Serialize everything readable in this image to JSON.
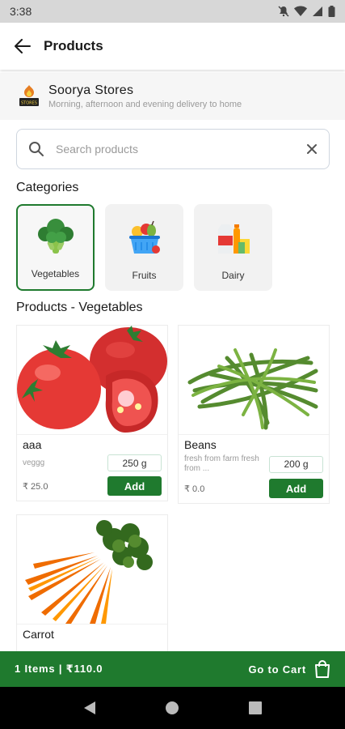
{
  "status_bar": {
    "time": "3:38"
  },
  "app_bar": {
    "title": "Products"
  },
  "store": {
    "name": "Soorya Stores",
    "description": "Morning, afternoon and evening delivery to home"
  },
  "search": {
    "placeholder": "Search products",
    "value": ""
  },
  "categories_title": "Categories",
  "categories": [
    {
      "label": "Vegetables",
      "selected": true
    },
    {
      "label": "Fruits",
      "selected": false
    },
    {
      "label": "Dairy",
      "selected": false
    }
  ],
  "products_title": "Products - Vegetables",
  "products": [
    {
      "name": "aaa",
      "description": "veggg",
      "quantity": "250 g",
      "price": "₹ 25.0",
      "add_label": "Add"
    },
    {
      "name": "Beans",
      "description": "fresh from farm fresh from ...",
      "quantity": "200 g",
      "price": "₹ 0.0",
      "add_label": "Add"
    },
    {
      "name": "Carrot"
    }
  ],
  "cart": {
    "summary": "1 Items | ₹110.0",
    "go_label": "Go to Cart"
  },
  "colors": {
    "primary": "#1f7a2e",
    "status_bar": "#d7d7d7",
    "nav_bar": "#000000"
  }
}
